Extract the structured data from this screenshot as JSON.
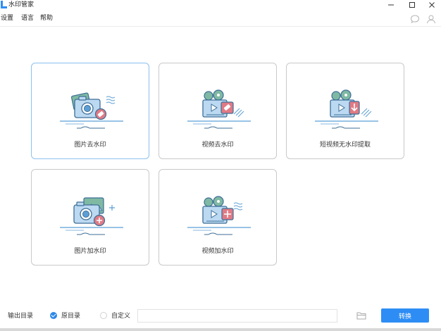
{
  "window": {
    "title": "水印管家",
    "controls": {
      "minimize": "minimize-icon",
      "maximize": "maximize-icon",
      "close": "close-icon"
    }
  },
  "menu": {
    "settings": "设置",
    "language": "语言",
    "help": "帮助"
  },
  "header_icons": [
    "chat-icon",
    "user-icon"
  ],
  "cards": [
    {
      "label": "图片去水印",
      "icon": "photo-remove-watermark-icon",
      "active": true
    },
    {
      "label": "视频去水印",
      "icon": "video-remove-watermark-icon",
      "active": false
    },
    {
      "label": "短视频无水印提取",
      "icon": "short-video-extract-icon",
      "active": false
    },
    {
      "label": "图片加水印",
      "icon": "photo-add-watermark-icon",
      "active": false
    },
    {
      "label": "视频加水印",
      "icon": "video-add-watermark-icon",
      "active": false
    }
  ],
  "output": {
    "label": "输出目录",
    "options": [
      {
        "label": "原目录",
        "selected": true
      },
      {
        "label": "自定义",
        "selected": false
      }
    ],
    "path_value": "",
    "convert_label": "转换"
  },
  "colors": {
    "accent": "#2e8df5",
    "icon_blue": "#5b9fd6",
    "icon_teal": "#7fb9a3",
    "icon_red": "#e07a84",
    "active_border": "#8cc0ef"
  }
}
